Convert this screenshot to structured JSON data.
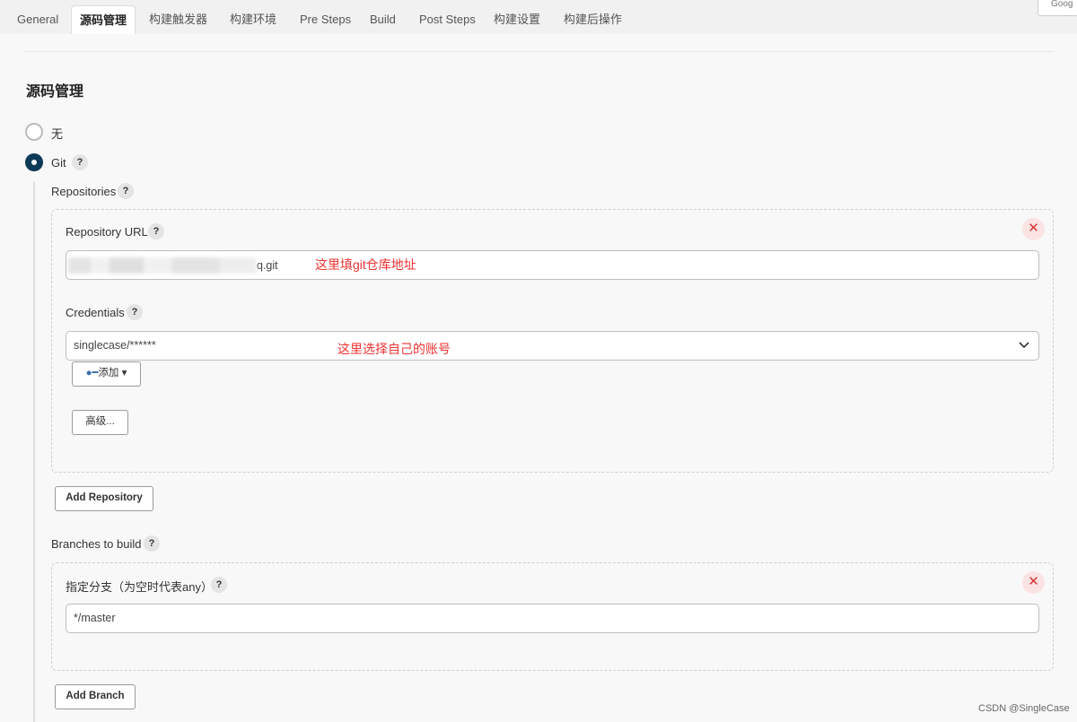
{
  "tabs": [
    {
      "label": "General"
    },
    {
      "label": "源码管理",
      "active": true
    },
    {
      "label": "构建触发器"
    },
    {
      "label": "构建环境"
    },
    {
      "label": "Pre Steps"
    },
    {
      "label": "Build"
    },
    {
      "label": "Post Steps"
    },
    {
      "label": "构建设置"
    },
    {
      "label": "构建后操作"
    }
  ],
  "corner_label": "Goog",
  "section_title": "源码管理",
  "scm": {
    "none_label": "无",
    "git_label": "Git",
    "selected": "Git"
  },
  "repositories": {
    "label": "Repositories",
    "url_label": "Repository URL",
    "url_value": "q.git",
    "url_note": "这里填git仓库地址",
    "credentials_label": "Credentials",
    "credentials_value": "singlecase/******",
    "credentials_note": "这里选择自己的账号",
    "add_label": "添加",
    "advanced_label": "高级...",
    "add_repository_label": "Add Repository"
  },
  "branches": {
    "label": "Branches to build",
    "spec_label": "指定分支（为空时代表any）",
    "spec_value": "*/master",
    "add_branch_label": "Add Branch"
  },
  "watermark": "CSDN @SingleCase"
}
